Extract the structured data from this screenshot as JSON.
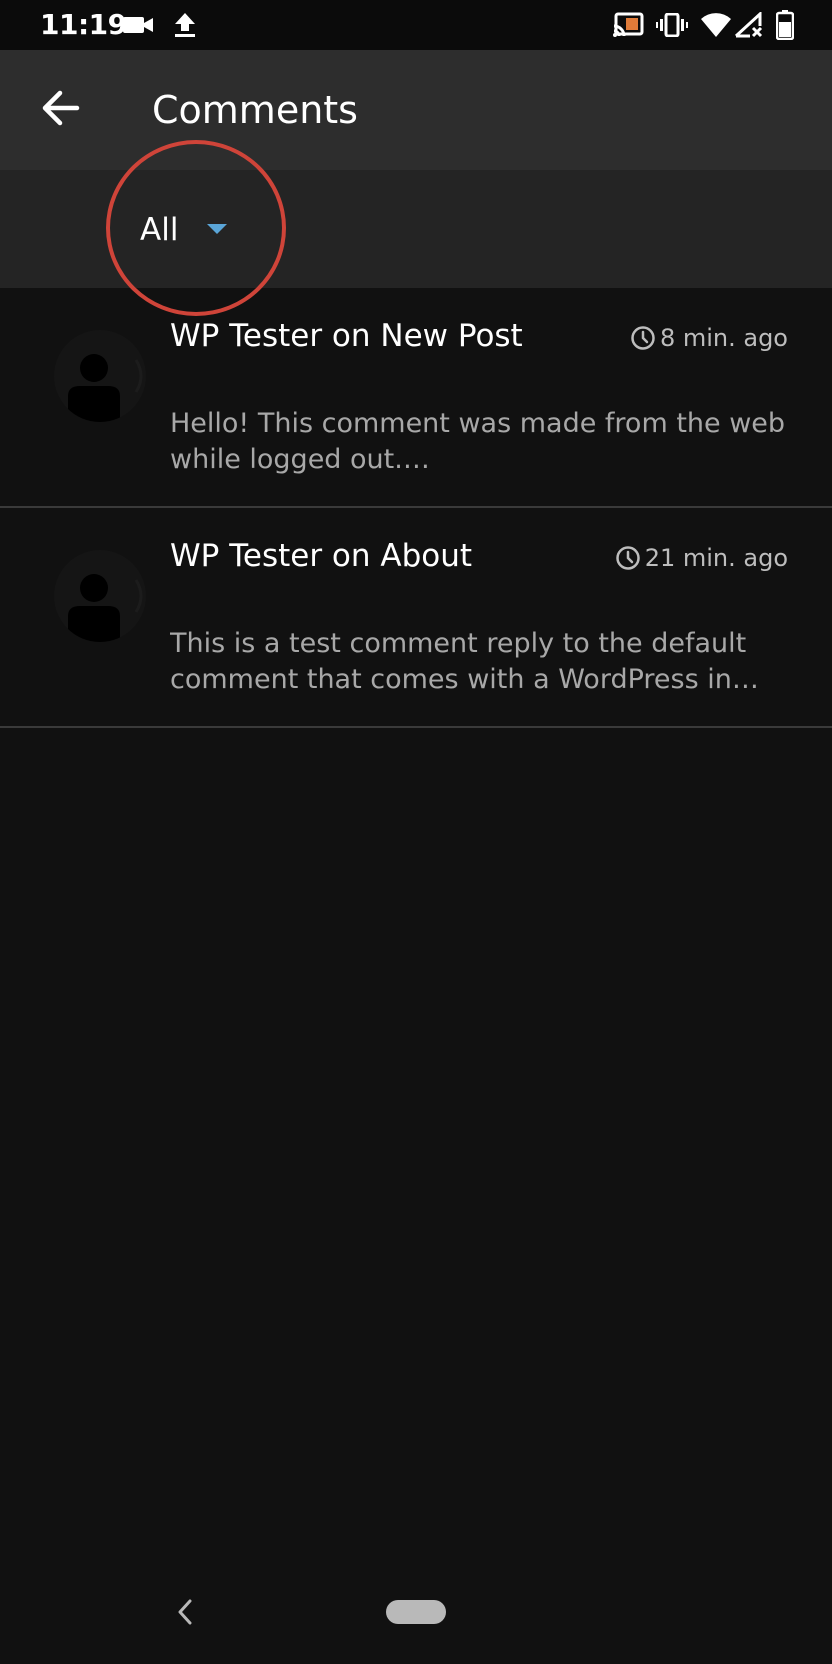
{
  "status_bar": {
    "time": "11:19",
    "left_icons": [
      "video-camera-icon",
      "upload-icon"
    ],
    "right_icons": [
      "cast-icon",
      "vibrate-icon",
      "wifi-icon",
      "cellular-no-signal-icon",
      "battery-icon"
    ]
  },
  "app_bar": {
    "title": "Comments",
    "back_icon": "arrow-left-icon"
  },
  "filter": {
    "selected": "All",
    "caret_color": "#5aa5d8"
  },
  "comments": [
    {
      "title": "WP Tester on New Post",
      "time": "8 min. ago",
      "excerpt": "Hello! This comment was made from the web while logged out.…"
    },
    {
      "title": "WP Tester on About",
      "time": "21 min. ago",
      "excerpt": "This is a test comment reply to the default comment that comes with a WordPress in…"
    }
  ],
  "colors": {
    "background": "#111111",
    "app_bar": "#2d2d2d",
    "filter_bar": "#242424",
    "highlight": "#cf4439"
  }
}
